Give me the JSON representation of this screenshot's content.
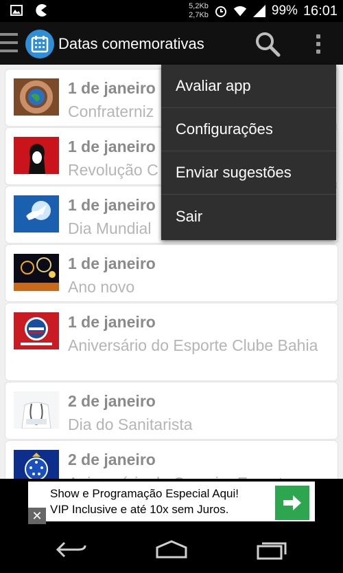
{
  "status_bar": {
    "net_up": "5,2Kb",
    "net_down": "2,7Kb",
    "battery": "99%",
    "time": "16:01",
    "icons": [
      "gallery-icon",
      "pacman-icon",
      "alarm-icon",
      "wifi-icon",
      "signal-icon",
      "battery-icon"
    ]
  },
  "action_bar": {
    "title": "Datas comemorativas",
    "icons": [
      "drawer-icon",
      "calendar-icon",
      "search-icon",
      "overflow-icon"
    ]
  },
  "list": {
    "items": [
      {
        "date": "1 de janeiro",
        "title": "Confraterniz"
      },
      {
        "date": "1 de janeiro",
        "title": "Revolução C"
      },
      {
        "date": "1 de janeiro",
        "title": "Dia Mundial"
      },
      {
        "date": "1 de janeiro",
        "title": "Ano novo"
      },
      {
        "date": "1 de janeiro",
        "title": "Aniversário do Esporte Clube Bahia"
      },
      {
        "date": "2 de janeiro",
        "title": "Dia do Sanitarista"
      },
      {
        "date": "2 de janeiro",
        "title": "Aniversário do Cruzeiro Esporte"
      }
    ]
  },
  "menu": {
    "items": [
      {
        "label": "Avaliar app"
      },
      {
        "label": "Configurações"
      },
      {
        "label": "Enviar sugestões"
      },
      {
        "label": "Sair"
      }
    ]
  },
  "ad": {
    "line1": "Show e Programação Especial Aqui!",
    "line2": "VIP Inclusive e até 10x sem Juros.",
    "close_label": "✕"
  },
  "colors": {
    "accent": "#2f8fd6",
    "ad_button": "#2ea64f",
    "menu_bg": "#2f2f2f"
  }
}
